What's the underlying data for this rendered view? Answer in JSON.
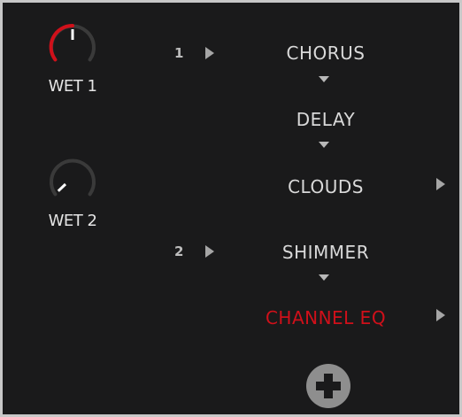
{
  "knobs": [
    {
      "label": "WET 1",
      "level": 0.5,
      "accent": "#d0101a"
    },
    {
      "label": "WET 2",
      "level": 0.0,
      "accent": "#d0101a"
    }
  ],
  "chain": {
    "row1_number": "1",
    "row2_number": "2",
    "effects": [
      {
        "name": "CHORUS"
      },
      {
        "name": "DELAY"
      },
      {
        "name": "CLOUDS"
      },
      {
        "name": "SHIMMER"
      },
      {
        "name": "CHANNEL EQ",
        "selected": true
      }
    ]
  },
  "icons": {
    "routing": "play-triangle-icon",
    "connector": "down-triangle-icon",
    "add": "plus-circle-icon"
  },
  "colors": {
    "background": "#1a1a1b",
    "text": "#d9d9d9",
    "accent_red": "#d0101a",
    "knob_track": "#3a3a3a"
  }
}
